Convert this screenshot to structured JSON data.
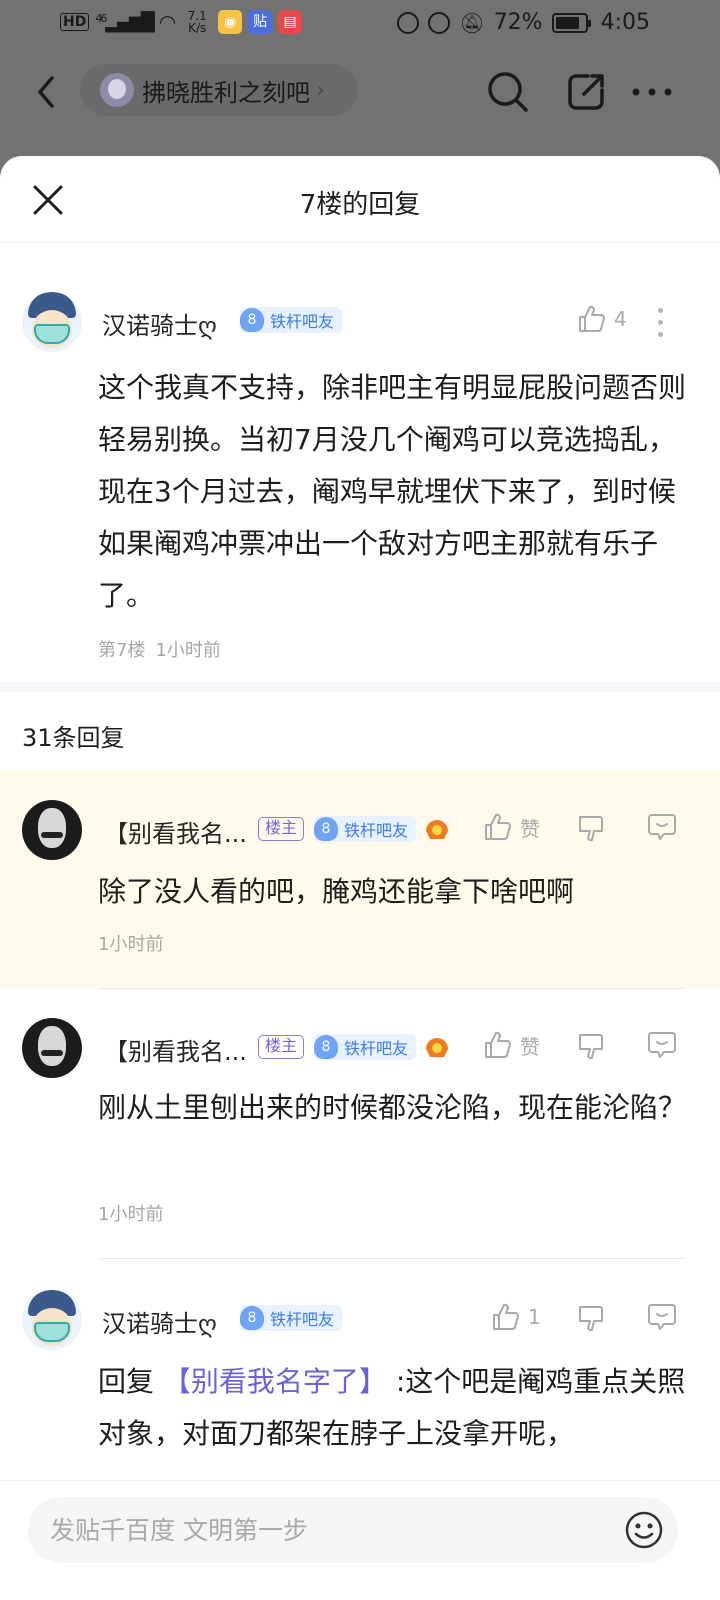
{
  "status_bar": {
    "hd": "HD",
    "network": "46",
    "speed_value": "7.1",
    "speed_unit": "K/s",
    "app_badge_2": "贴",
    "battery": "72%",
    "battery_level": 0.72,
    "time": "4:05"
  },
  "nav": {
    "forum_name": "拂晓胜利之刻吧"
  },
  "sheet": {
    "title": "7楼的回复"
  },
  "main_post": {
    "username": "汉诺骑士ღ",
    "level": "8",
    "level_title": "铁杆吧友",
    "likes": "4",
    "text": "这个我真不支持，除非吧主有明显屁股问题否则轻易别换。当初7月没几个阉鸡可以竞选捣乱，现在3个月过去，阉鸡早就埋伏下来了，到时候如果阉鸡冲票冲出一个敌对方吧主那就有乐子了。",
    "floor": "第7楼",
    "time": "1小时前"
  },
  "replies_count": "31条回复",
  "replies": [
    {
      "username": "【别看我名...",
      "owner_badge": "楼主",
      "level": "8",
      "level_title": "铁杆吧友",
      "likes": "赞",
      "text": "除了没人看的吧，腌鸡还能拿下啥吧啊",
      "time": "1小时前"
    },
    {
      "username": "【别看我名...",
      "owner_badge": "楼主",
      "level": "8",
      "level_title": "铁杆吧友",
      "likes": "赞",
      "text": "刚从土里刨出来的时候都没沦陷，现在能沦陷？",
      "time": "1小时前"
    },
    {
      "username": "汉诺骑士ღ",
      "level": "8",
      "level_title": "铁杆吧友",
      "likes": "1",
      "reply_prefix": "回复 ",
      "reply_target": "【别看我名字了】",
      "text": " :这个吧是阉鸡重点关照对象，对面刀都架在脖子上没拿开呢，"
    }
  ],
  "input": {
    "placeholder": "发贴千百度 文明第一步"
  },
  "colors": {
    "accent": "#6a63d8",
    "level_badge": "#6ea3f5",
    "highlight_bg": "#fffaec"
  }
}
